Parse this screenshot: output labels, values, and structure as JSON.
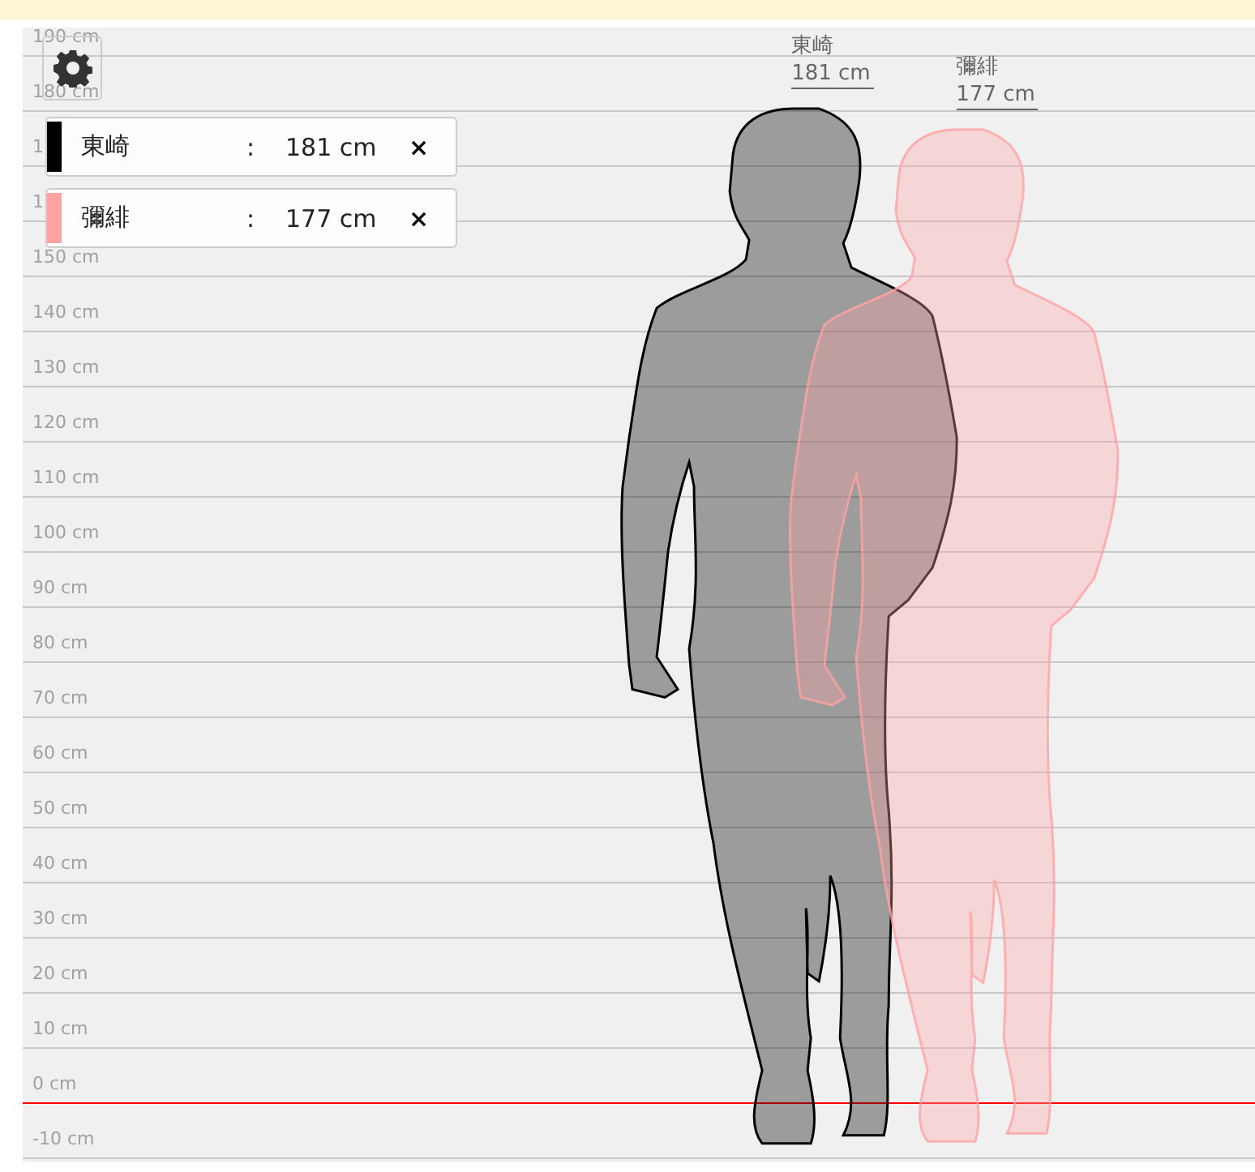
{
  "scale": [
    {
      "label": "190 cm",
      "baseline": false
    },
    {
      "label": "180 cm",
      "baseline": false
    },
    {
      "label": "1",
      "baseline": false
    },
    {
      "label": "1",
      "baseline": false
    },
    {
      "label": "150 cm",
      "baseline": false
    },
    {
      "label": "140 cm",
      "baseline": false
    },
    {
      "label": "130 cm",
      "baseline": false
    },
    {
      "label": "120 cm",
      "baseline": false
    },
    {
      "label": "110 cm",
      "baseline": false
    },
    {
      "label": "100 cm",
      "baseline": false
    },
    {
      "label": "90 cm",
      "baseline": false
    },
    {
      "label": "80 cm",
      "baseline": false
    },
    {
      "label": "70 cm",
      "baseline": false
    },
    {
      "label": "60 cm",
      "baseline": false
    },
    {
      "label": "50 cm",
      "baseline": false
    },
    {
      "label": "40 cm",
      "baseline": false
    },
    {
      "label": "30 cm",
      "baseline": false
    },
    {
      "label": "20 cm",
      "baseline": false
    },
    {
      "label": "10 cm",
      "baseline": false
    },
    {
      "label": "0 cm",
      "baseline": true
    },
    {
      "label": "-10 cm",
      "baseline": false
    }
  ],
  "people": [
    {
      "name": "東崎",
      "separator": ":",
      "height": "181 cm",
      "remove": "×",
      "color": "#000000",
      "tag_name": "東崎",
      "tag_height": "181 cm"
    },
    {
      "name": "彌緋",
      "separator": ":",
      "height": "177 cm",
      "remove": "×",
      "color": "#ffa3a3",
      "tag_name": "彌緋",
      "tag_height": "177 cm"
    }
  ]
}
